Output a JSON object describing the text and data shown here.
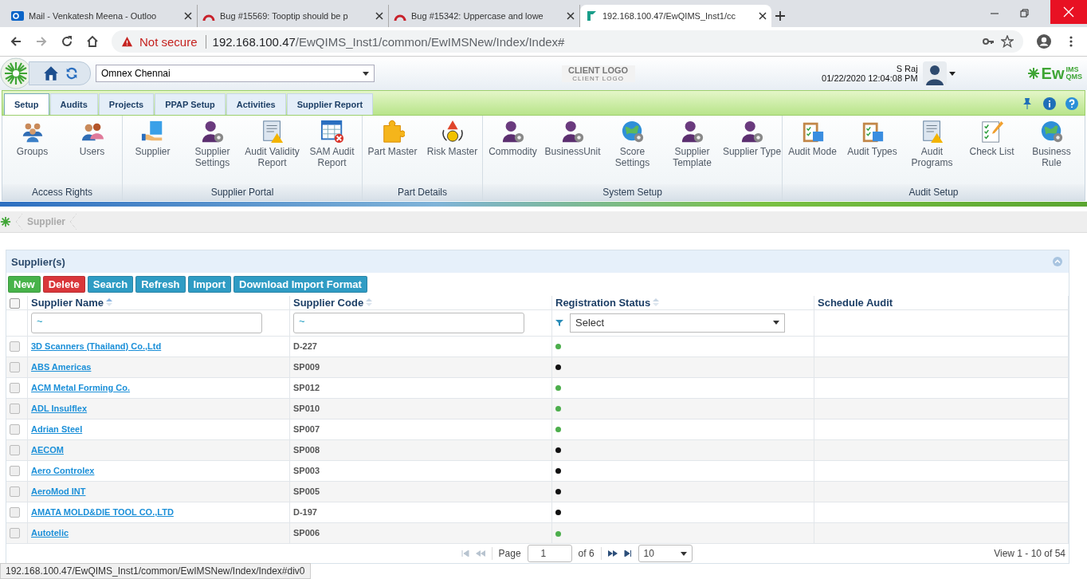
{
  "browser": {
    "tabs": [
      {
        "title": "Mail - Venkatesh Meena - Outloo",
        "kind": "mail",
        "selected": false
      },
      {
        "title": "Bug #15569: Tooptip should be p",
        "kind": "bug",
        "selected": false
      },
      {
        "title": "Bug #15342: Uppercase and lowe",
        "kind": "bug",
        "selected": false
      },
      {
        "title": "192.168.100.47/EwQIMS_Inst1/cc",
        "kind": "app",
        "selected": true
      }
    ],
    "security": "Not secure",
    "url_host": "192.168.100.47",
    "url_path": "/EwQIMS_Inst1/common/EwIMSNew/Index/Index#"
  },
  "header": {
    "site": "Omnex Chennai",
    "client_logo": "CLIENT LOGO",
    "client_logo_sub": "CLIENT LOGO",
    "user": "S Raj",
    "datetime": "01/22/2020 12:04:08 PM",
    "brand": "Ew",
    "brand_sup": "IMS",
    "brand_sub": "QMS"
  },
  "menu_tabs": [
    {
      "label": "Setup",
      "selected": true
    },
    {
      "label": "Audits",
      "selected": false
    },
    {
      "label": "Projects",
      "selected": false
    },
    {
      "label": "PPAP Setup",
      "selected": false
    },
    {
      "label": "Activities",
      "selected": false
    },
    {
      "label": "Supplier Report",
      "selected": false
    }
  ],
  "ribbon": [
    {
      "label": "Access Rights",
      "items": [
        {
          "label": "Groups",
          "kind": "group"
        },
        {
          "label": "Users",
          "kind": "users"
        }
      ]
    },
    {
      "label": "Supplier Portal",
      "items": [
        {
          "label": "Supplier",
          "kind": "hand"
        },
        {
          "label": "Supplier Settings",
          "kind": "person"
        },
        {
          "label": "Audit Validity Report",
          "kind": "report"
        },
        {
          "label": "SAM Audit Report",
          "kind": "grid"
        }
      ]
    },
    {
      "label": "Part Details",
      "items": [
        {
          "label": "Part Master",
          "kind": "puzzle"
        },
        {
          "label": "Risk Master",
          "kind": "risk"
        }
      ]
    },
    {
      "label": "System Setup",
      "items": [
        {
          "label": "Commodity",
          "kind": "person"
        },
        {
          "label": "BusinessUnit",
          "kind": "person"
        },
        {
          "label": "Score Settings",
          "kind": "globe"
        },
        {
          "label": "Supplier Template",
          "kind": "person"
        },
        {
          "label": "Supplier Type",
          "kind": "person"
        }
      ]
    },
    {
      "label": "Audit Setup",
      "items": [
        {
          "label": "Audit Mode",
          "kind": "clipboard"
        },
        {
          "label": "Audit Types",
          "kind": "clipboard"
        },
        {
          "label": "Audit Programs",
          "kind": "report"
        },
        {
          "label": "Check List",
          "kind": "checklist"
        },
        {
          "label": "Business Rule",
          "kind": "globe"
        }
      ]
    }
  ],
  "breadcrumb": "Supplier",
  "panel_title": "Supplier(s)",
  "buttons": [
    {
      "label": "New",
      "kind": "green"
    },
    {
      "label": "Delete",
      "kind": "red"
    },
    {
      "label": "Search",
      "kind": "blue"
    },
    {
      "label": "Refresh",
      "kind": "blue"
    },
    {
      "label": "Import",
      "kind": "blue"
    },
    {
      "label": "Download Import Format",
      "kind": "blue"
    }
  ],
  "table": {
    "select_all": {
      "checked": false
    },
    "columns": [
      "Supplier Name",
      "Supplier Code",
      "Registration Status",
      "Schedule Audit"
    ],
    "filters": {
      "name": "~",
      "code": "~",
      "status": "Select"
    },
    "rows": [
      {
        "name": "3D Scanners (Thailand) Co.,Ltd",
        "code": "D-227",
        "color": "#4cae4c",
        "checked": false
      },
      {
        "name": "ABS Americas",
        "code": "SP009",
        "color": "#111111",
        "checked": false
      },
      {
        "name": "ACM Metal Forming Co.",
        "code": "SP012",
        "color": "#4cae4c",
        "checked": false
      },
      {
        "name": "ADL Insulflex",
        "code": "SP010",
        "color": "#4cae4c",
        "checked": false
      },
      {
        "name": "Adrian Steel",
        "code": "SP007",
        "color": "#4cae4c",
        "checked": false
      },
      {
        "name": "AECOM",
        "code": "SP008",
        "color": "#111111",
        "checked": false
      },
      {
        "name": "Aero Controlex",
        "code": "SP003",
        "color": "#111111",
        "checked": false
      },
      {
        "name": "AeroMod INT",
        "code": "SP005",
        "color": "#111111",
        "checked": false
      },
      {
        "name": "AMATA MOLD&DIE TOOL CO.,LTD",
        "code": "D-197",
        "color": "#111111",
        "checked": false
      },
      {
        "name": "Autotelic",
        "code": "SP006",
        "color": "#4cae4c",
        "checked": false
      }
    ]
  },
  "pager": {
    "page_label": "Page",
    "page": "1",
    "of": "of 6",
    "size": "10",
    "view": "View 1 - 10 of 54"
  },
  "status_url": "192.168.100.47/EwQIMS_Inst1/common/EwIMSNew/Index/Index#div0"
}
